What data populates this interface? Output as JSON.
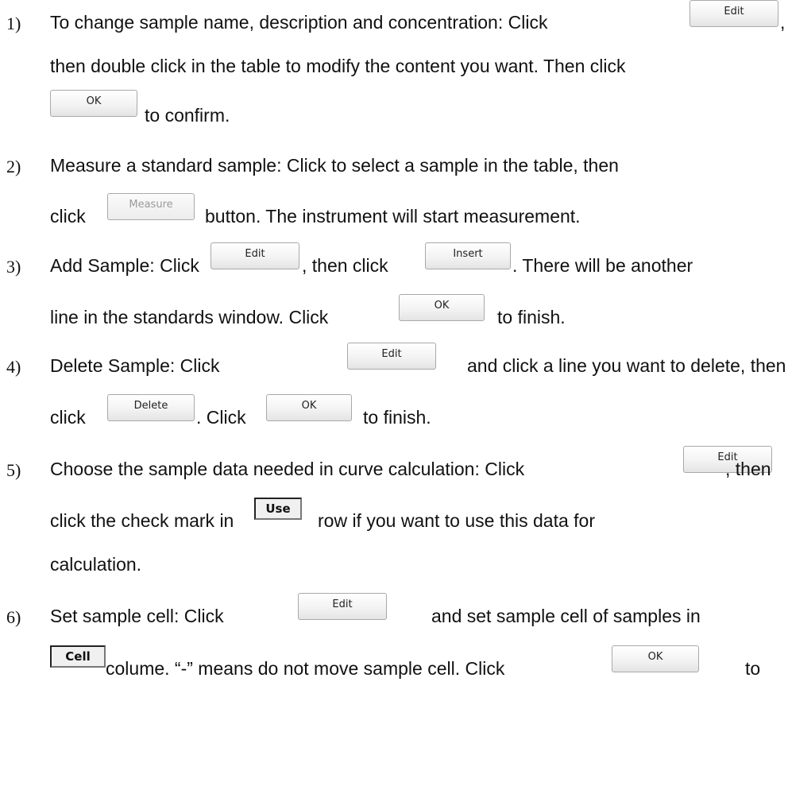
{
  "items": [
    {
      "num": "1)",
      "l1a": "To change sample name, description and concentration: Click",
      "l1b": ",",
      "l2": "then double click in the table to modify the content you want. Then click",
      "l3": "to confirm.",
      "btn_edit": "Edit",
      "btn_ok": "OK"
    },
    {
      "num": "2)",
      "l1": "Measure a standard sample: Click to select a sample in the table, then",
      "l2a": "click",
      "l2b": "button. The instrument will start measurement.",
      "btn_measure": "Measure"
    },
    {
      "num": "3)",
      "l1a": "Add Sample: Click",
      "l1b": ", then click",
      "l1c": ". There will be another",
      "l2a": "line in the standards window. Click",
      "l2b": "to finish.",
      "btn_edit": "Edit",
      "btn_insert": "Insert",
      "btn_ok": "OK"
    },
    {
      "num": "4)",
      "l1a": "Delete Sample: Click",
      "l1b": "and click a line you want to delete, then",
      "l2a": "click",
      "l2b": ". Click",
      "l2c": "to finish.",
      "btn_edit": "Edit",
      "btn_delete": "Delete",
      "btn_ok": "OK"
    },
    {
      "num": "5)",
      "l1a": "Choose the sample data needed in curve calculation: Click",
      "l1b": ", then",
      "l2a": "click the check mark in",
      "l2b": "row if you want to use this data for",
      "l3": "calculation.",
      "btn_edit": "Edit",
      "hdr_use": "Use"
    },
    {
      "num": "6)",
      "l1a": "Set sample cell: Click",
      "l1b": "and set sample cell of samples in",
      "l2a": "colume. “-” means do not move sample cell. Click",
      "l2b": "to",
      "btn_edit": "Edit",
      "hdr_cell": "Cell",
      "btn_ok": "OK"
    }
  ]
}
